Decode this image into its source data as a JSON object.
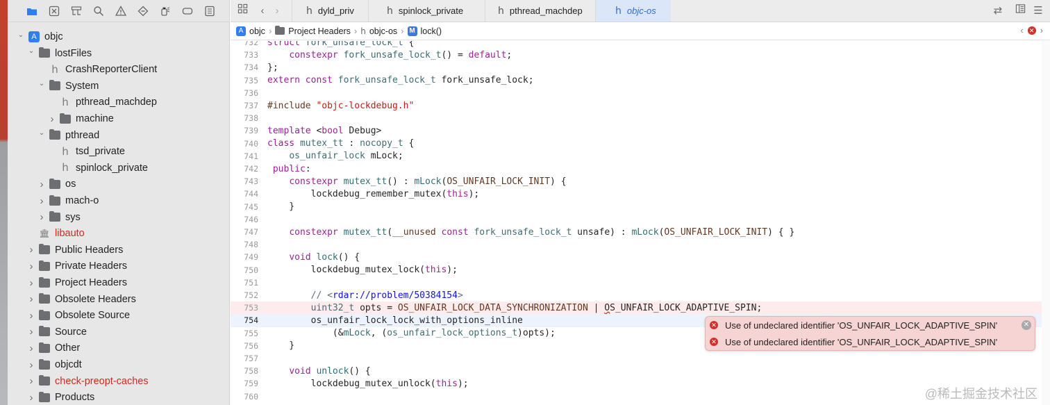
{
  "sidebar": {
    "toolbar": [
      "folder-icon",
      "xmark-square-icon",
      "hierarchy-icon",
      "magnifier-icon",
      "warning-icon",
      "diamond-icon",
      "spray-icon",
      "label-icon",
      "list-icon"
    ],
    "tree": [
      {
        "label": "objc",
        "kind": "project",
        "indent": 0,
        "chevron": "down"
      },
      {
        "label": "lostFiles",
        "kind": "folder",
        "indent": 1,
        "chevron": "down"
      },
      {
        "label": "CrashReporterClient",
        "kind": "header",
        "indent": 2,
        "chevron": ""
      },
      {
        "label": "System",
        "kind": "folder",
        "indent": 2,
        "chevron": "down"
      },
      {
        "label": "pthread_machdep",
        "kind": "header",
        "indent": 3,
        "chevron": ""
      },
      {
        "label": "machine",
        "kind": "folder",
        "indent": 3,
        "chevron": "right"
      },
      {
        "label": "pthread",
        "kind": "folder",
        "indent": 2,
        "chevron": "down"
      },
      {
        "label": "tsd_private",
        "kind": "header",
        "indent": 3,
        "chevron": ""
      },
      {
        "label": "spinlock_private",
        "kind": "header",
        "indent": 3,
        "chevron": ""
      },
      {
        "label": "os",
        "kind": "folder",
        "indent": 2,
        "chevron": "right"
      },
      {
        "label": "mach-o",
        "kind": "folder",
        "indent": 2,
        "chevron": "right"
      },
      {
        "label": "sys",
        "kind": "folder",
        "indent": 2,
        "chevron": "right"
      },
      {
        "label": "libauto",
        "kind": "library",
        "indent": 1,
        "chevron": "",
        "red": true
      },
      {
        "label": "Public Headers",
        "kind": "folder",
        "indent": 1,
        "chevron": "right"
      },
      {
        "label": "Private Headers",
        "kind": "folder",
        "indent": 1,
        "chevron": "right"
      },
      {
        "label": "Project Headers",
        "kind": "folder",
        "indent": 1,
        "chevron": "right"
      },
      {
        "label": "Obsolete Headers",
        "kind": "folder",
        "indent": 1,
        "chevron": "right"
      },
      {
        "label": "Obsolete Source",
        "kind": "folder",
        "indent": 1,
        "chevron": "right"
      },
      {
        "label": "Source",
        "kind": "folder",
        "indent": 1,
        "chevron": "right"
      },
      {
        "label": "Other",
        "kind": "folder",
        "indent": 1,
        "chevron": "right"
      },
      {
        "label": "objcdt",
        "kind": "folder",
        "indent": 1,
        "chevron": "right"
      },
      {
        "label": "check-preopt-caches",
        "kind": "folder",
        "indent": 1,
        "chevron": "right",
        "red": true
      },
      {
        "label": "Products",
        "kind": "folder",
        "indent": 1,
        "chevron": "right"
      }
    ]
  },
  "tabs": [
    {
      "label": "dyld_priv",
      "active": false
    },
    {
      "label": "spinlock_private",
      "active": false
    },
    {
      "label": "pthread_machdep",
      "active": false
    },
    {
      "label": "objc-os",
      "active": true
    }
  ],
  "jumpbar": {
    "crumbs": [
      "objc",
      "Project Headers",
      "objc-os",
      "lock()"
    ]
  },
  "editor": {
    "current_line": "754",
    "error_line": "753",
    "lines": [
      {
        "n": "732",
        "html": "<span class='k'>struct</span> <span class='t'>fork_unsafe_lock_t</span> {"
      },
      {
        "n": "733",
        "html": "    <span class='k'>constexpr</span> <span class='f'>fork_unsafe_lock_t</span>() = <span class='k'>default</span>;"
      },
      {
        "n": "734",
        "html": "};"
      },
      {
        "n": "735",
        "html": "<span class='k'>extern</span> <span class='k'>const</span> <span class='t'>fork_unsafe_lock_t</span> fork_unsafe_lock;"
      },
      {
        "n": "736",
        "html": ""
      },
      {
        "n": "737",
        "html": "<span class='m'>#include</span> <span class='s'>\"objc-lockdebug.h\"</span>"
      },
      {
        "n": "738",
        "html": ""
      },
      {
        "n": "739",
        "html": "<span class='k'>template</span> &lt;<span class='k'>bool</span> Debug&gt;"
      },
      {
        "n": "740",
        "html": "<span class='k'>class</span> <span class='t'>mutex_tt</span> : <span class='t'>nocopy_t</span> {"
      },
      {
        "n": "741",
        "html": "    <span class='t'>os_unfair_lock</span> mLock;"
      },
      {
        "n": "742",
        "html": " <span class='k'>public</span>:"
      },
      {
        "n": "743",
        "html": "    <span class='k'>constexpr</span> <span class='f'>mutex_tt</span>() : <span class='f'>mLock</span>(<span class='m'>OS_UNFAIR_LOCK_INIT</span>) {"
      },
      {
        "n": "744",
        "html": "        lockdebug_remember_mutex(<span class='k'>this</span>);"
      },
      {
        "n": "745",
        "html": "    }"
      },
      {
        "n": "746",
        "html": ""
      },
      {
        "n": "747",
        "html": "    <span class='k'>constexpr</span> <span class='f'>mutex_tt</span>(<span class='m'>__unused</span> <span class='k'>const</span> <span class='t'>fork_unsafe_lock_t</span> unsafe) : <span class='f'>mLock</span>(<span class='m'>OS_UNFAIR_LOCK_INIT</span>) { }"
      },
      {
        "n": "748",
        "html": ""
      },
      {
        "n": "749",
        "html": "    <span class='k'>void</span> <span class='f'>lock</span>() {"
      },
      {
        "n": "750",
        "html": "        lockdebug_mutex_lock(<span class='k'>this</span>);"
      },
      {
        "n": "751",
        "html": ""
      },
      {
        "n": "752",
        "html": "        <span class='c'>// &lt;<span class='u'>rdar://problem/50384154</span>&gt;</span>"
      },
      {
        "n": "753",
        "html": "        <span class='t'>uint32_t</span> opts = <span class='m'>OS_UNFAIR_LOCK_DATA_SYNCHRONIZATION</span> | <span class='squig'>O</span>S_UNFAIR_LOCK_ADAPTIVE_SPIN;"
      },
      {
        "n": "754",
        "html": "        os_unfair_lock_lock_with_options_inline"
      },
      {
        "n": "755",
        "html": "            (&amp;<span class='f'>mLock</span>, (<span class='t'>os_unfair_lock_options_t</span>)opts);"
      },
      {
        "n": "756",
        "html": "    }"
      },
      {
        "n": "757",
        "html": ""
      },
      {
        "n": "758",
        "html": "    <span class='k'>void</span> <span class='f'>unlock</span>() {"
      },
      {
        "n": "759",
        "html": "        lockdebug_mutex_unlock(<span class='k'>this</span>);"
      },
      {
        "n": "760",
        "html": ""
      }
    ]
  },
  "errors": [
    "Use of undeclared identifier 'OS_UNFAIR_LOCK_ADAPTIVE_SPIN'",
    "Use of undeclared identifier 'OS_UNFAIR_LOCK_ADAPTIVE_SPIN'"
  ],
  "watermark": "@稀土掘金技术社区"
}
